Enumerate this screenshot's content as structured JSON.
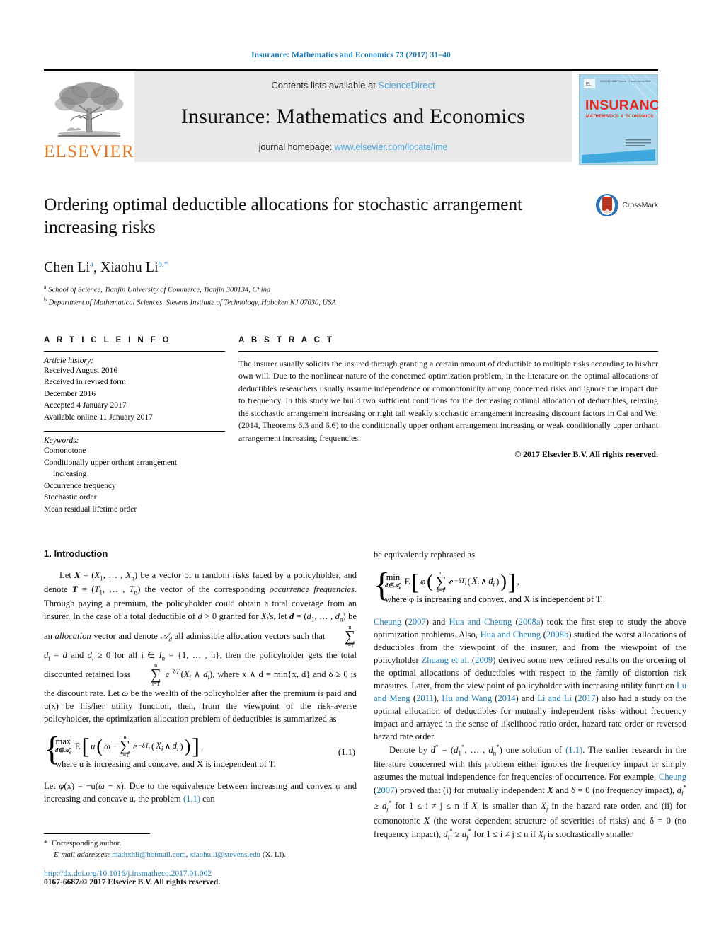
{
  "running_head": "Insurance: Mathematics and Economics 73 (2017) 31–40",
  "masthead": {
    "publisher_name": "ELSEVIER",
    "contents_prefix": "Contents lists available at ",
    "sciencedirect": "ScienceDirect",
    "journal_title": "Insurance: Mathematics and Economics",
    "homepage_prefix": "journal homepage: ",
    "homepage_url": "www.elsevier.com/locate/ime",
    "cover_title": "INSURANCE",
    "cover_subtitle": "MATHEMATICS & ECONOMICS"
  },
  "article": {
    "title": "Ordering optimal deductible allocations for stochastic arrangement increasing risks",
    "crossmark_label": "CrossMark",
    "authors": "Chen Li, Xiaohu Li",
    "author_marks": {
      "a": "a",
      "b": "b,*"
    },
    "affiliation_a": "School of Science, Tianjin University of Commerce, Tianjin 300134, China",
    "affiliation_b": "Department of Mathematical Sciences, Stevens Institute of Technology, Hoboken NJ 07030, USA"
  },
  "info": {
    "heading": "A R T I C L E   I N F O",
    "history_label": "Article history:",
    "history": [
      "Received August 2016",
      "Received in revised form",
      "December 2016",
      "Accepted 4 January 2017",
      "Available online 11 January 2017"
    ],
    "keywords_label": "Keywords:",
    "keywords": [
      "Comonotone",
      "Conditionally upper orthant arrangement",
      "increasing",
      "Occurrence frequency",
      "Stochastic order",
      "Mean residual lifetime order"
    ]
  },
  "abstract": {
    "heading": "A B S T R A C T",
    "text": "The insurer usually solicits the insured through granting a certain amount of deductible to multiple risks according to his/her own will. Due to the nonlinear nature of the concerned optimization problem, in the literature on the optimal allocations of deductibles researchers usually assume independence or comonotonicity among concerned risks and ignore the impact due to frequency. In this study we build two sufficient conditions for the decreasing optimal allocation of deductibles, relaxing the stochastic arrangement increasing or right tail weakly stochastic arrangement increasing discount factors in Cai and Wei (2014, Theorems 6.3 and 6.6) to the conditionally upper orthant arrangement increasing or weak conditionally upper orthant arrangement increasing frequencies.",
    "copyright": "© 2017 Elsevier B.V. All rights reserved."
  },
  "body": {
    "section_title": "1. Introduction",
    "left": {
      "p1_a": "Let ",
      "p1_text": "Let X = (X₁, …, Xₙ) be a vector of n random risks faced by a policyholder, and denote T = (T₁, …, Tₙ) the vector of the corresponding occurrence frequencies. Through paying a premium, the policyholder could obtain a total coverage from an insurer. In the case of a total deductible of d > 0 granted for Xᵢ's, let d = (d₁, …, dₙ) be an allocation vector and denote 𝒜_d all admissible allocation vectors such that Σᵢ₌₁ⁿ dᵢ = d and dᵢ ≥ 0 for all i ∈ Iₙ = {1, …, n}, then the policyholder gets the total discounted retained loss Σᵢ₌₁ⁿ e^{−δTᵢ}(Xᵢ ∧ dᵢ), where x ∧ d = min{x, d} and δ ≥ 0 is the discount rate. Let ω be the wealth of the policyholder after the premium is paid and u(x) be his/her utility function, then, from the viewpoint of the risk-averse policyholder, the optimization allocation problem of deductibles is summarized as",
      "eq_tag": "(1.1)",
      "eq_where": "where u is increasing and concave, and X is independent of T.",
      "p2_text": "Let φ(x) = −u(ω − x). Due to the equivalence between increasing and convex φ and increasing and concave u, the problem (1.1) can",
      "p2_ref": "(1.1)"
    },
    "right": {
      "lead": "be equivalently rephrased as",
      "eq_where": "where φ is increasing and convex, and X is independent of T.",
      "p1_text": "Cheung (2007) and Hua and Cheung (2008a) took the first step to study the above optimization problems. Also, Hua and Cheung (2008b) studied the worst allocations of deductibles from the viewpoint of the insurer, and from the viewpoint of the policyholder Zhuang et al. (2009) derived some new refined results on the ordering of the optimal allocations of deductibles with respect to the family of distortion risk measures. Later, from the view point of policyholder with increasing utility function Lu and Meng (2011), Hu and Wang (2014) and Li and Li (2017) also had a study on the optimal allocation of deductibles for mutually independent risks without frequency impact and arrayed in the sense of likelihood ratio order, hazard rate order or reversed hazard rate order.",
      "p2_text": "Denote by d* = (d₁*, …, dₙ*) one solution of (1.1). The earlier research in the literature concerned with this problem either ignores the frequency impact or simply assumes the mutual independence for frequencies of occurrence. For example, Cheung (2007) proved that (i) for mutually independent X and δ = 0 (no frequency impact), dᵢ* ≥ dⱼ* for 1 ≤ i ≠ j ≤ n if Xᵢ is smaller than Xⱼ in the hazard rate order, and (ii) for comonotonic X (the worst dependent structure of severities of risks) and δ = 0 (no frequency impact), dᵢ* ≥ dⱼ* for 1 ≤ i ≠ j ≤ n if Xᵢ is stochastically smaller",
      "refs": [
        "Cheung",
        "Hua and Cheung",
        "Hua and Cheung",
        "Zhuang et al.",
        "Lu and Meng",
        "Hu and Wang",
        "Li and Li",
        "Cheung"
      ],
      "years": [
        "2007",
        "2008a",
        "2008b",
        "2009",
        "2011",
        "2014",
        "2017",
        "2007"
      ]
    }
  },
  "footnote": {
    "corresponding": "Corresponding author.",
    "email_label": "E-mail addresses:",
    "email1": "mathxhli@hotmail.com",
    "email2": "xiaohu.li@stevens.edu",
    "email_suffix": " (X. Li).",
    "doi": "http://dx.doi.org/10.1016/j.insmatheco.2017.01.002",
    "issn": "0167-6687/© 2017 Elsevier B.V. All rights reserved."
  },
  "colors": {
    "link_blue": "#1a7bb5",
    "sd_blue": "#4aa3d9",
    "elsevier_orange": "#E87722",
    "band_gray": "#e9e9e9",
    "cover_blue": "#a9d8ef",
    "cover_red": "#e8281e"
  }
}
